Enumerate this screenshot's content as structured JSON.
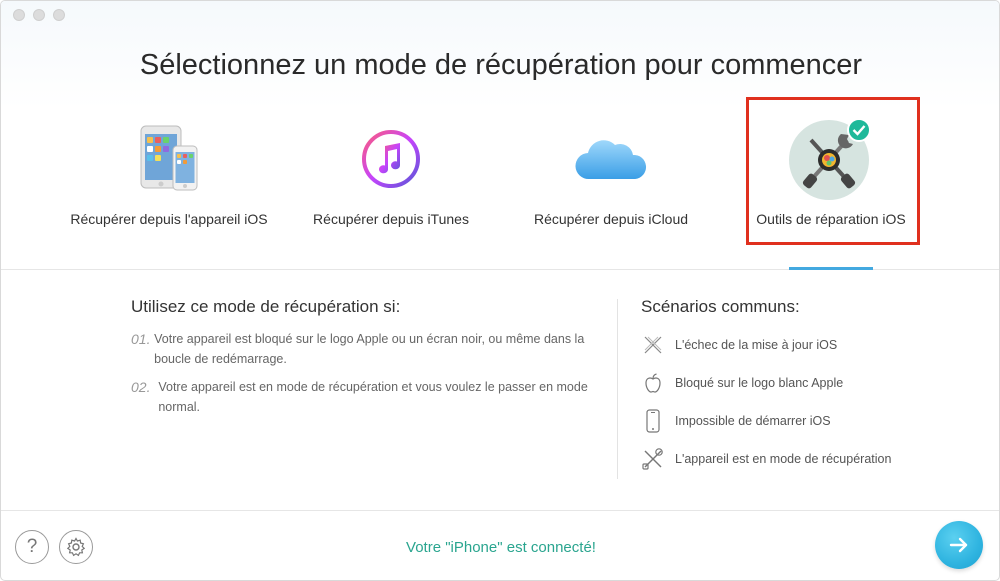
{
  "title": "Sélectionnez un mode de récupération pour commencer",
  "modes": [
    {
      "label": "Récupérer depuis l'appareil iOS",
      "icon": "ios-device-icon",
      "selected": false
    },
    {
      "label": "Récupérer depuis iTunes",
      "icon": "itunes-icon",
      "selected": false
    },
    {
      "label": "Récupérer depuis iCloud",
      "icon": "icloud-icon",
      "selected": false
    },
    {
      "label": "Outils de réparation iOS",
      "icon": "repair-tools-icon",
      "selected": true
    }
  ],
  "usage": {
    "title": "Utilisez ce mode de récupération si:",
    "items": [
      {
        "num": "01.",
        "text": "Votre appareil est bloqué sur le logo Apple ou un écran noir, ou même dans la boucle de redémarrage."
      },
      {
        "num": "02.",
        "text": "Votre appareil est en mode de récupération et vous voulez le passer en mode normal."
      }
    ]
  },
  "scenarios": {
    "title": "Scénarios communs:",
    "items": [
      {
        "icon": "update-failed-icon",
        "text": "L'échec de la mise à jour iOS"
      },
      {
        "icon": "apple-logo-icon",
        "text": "Bloqué sur le logo blanc Apple"
      },
      {
        "icon": "phone-icon",
        "text": "Impossible de démarrer iOS"
      },
      {
        "icon": "tools-icon",
        "text": "L'appareil est en mode de récupération"
      }
    ]
  },
  "footer": {
    "help_label": "?",
    "status": "Votre \"iPhone\" est connecté!"
  },
  "colors": {
    "accent": "#43a9e0",
    "status": "#2aa58f",
    "selection": "#e0301e",
    "check": "#1fb99a"
  }
}
